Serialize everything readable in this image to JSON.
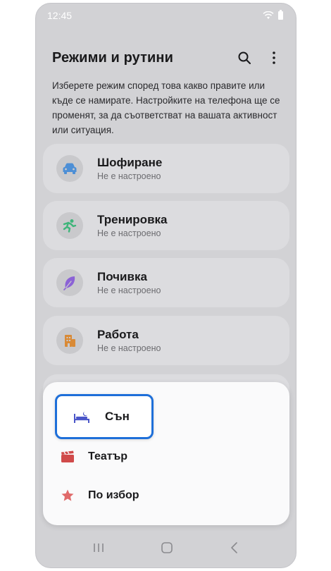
{
  "status_bar": {
    "time": "12:45"
  },
  "header": {
    "title": "Режими и рутини"
  },
  "description": "Изберете режим според това какво правите или къде се намирате. Настройките на телефона ще се променят, за да съответстват на вашата активност или ситуация.",
  "modes": [
    {
      "title": "Шофиране",
      "subtitle": "Не е настроено",
      "icon": "car-icon",
      "color": "#4d8fd6"
    },
    {
      "title": "Тренировка",
      "subtitle": "Не е настроено",
      "icon": "running-icon",
      "color": "#3fb57a"
    },
    {
      "title": "Почивка",
      "subtitle": "Не е настроено",
      "icon": "leaf-icon",
      "color": "#8b62d6"
    },
    {
      "title": "Работа",
      "subtitle": "Не е настроено",
      "icon": "building-icon",
      "color": "#d98a36"
    }
  ],
  "popup": {
    "items": [
      {
        "label": "Сън",
        "icon": "bed-icon",
        "color": "#4a56c9"
      },
      {
        "label": "Театър",
        "icon": "clapperboard-icon",
        "color": "#d04a4a"
      },
      {
        "label": "По избор",
        "icon": "star-icon",
        "color": "#e06a6a"
      }
    ],
    "highlight_color": "#1e6fd9"
  }
}
